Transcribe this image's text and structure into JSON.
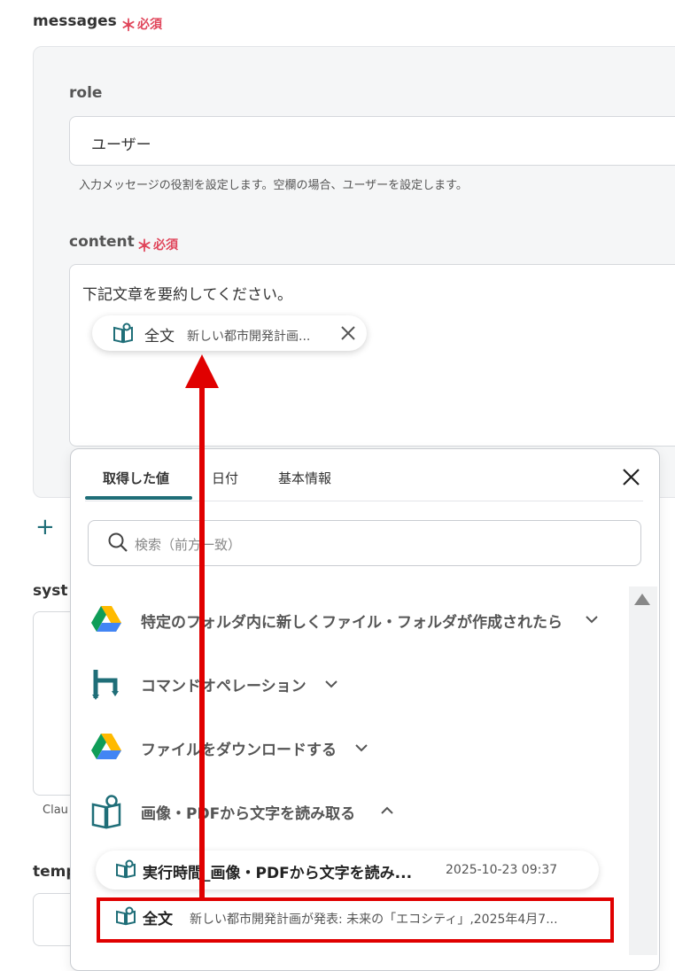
{
  "messages": {
    "label": "messages",
    "required_star": "＊",
    "required_text": "必須",
    "role": {
      "label": "role",
      "value": "ユーザー",
      "hint": "入力メッセージの役割を設定します。空欄の場合、ユーザーを設定します。"
    },
    "content": {
      "label": "content",
      "required_star": "＊",
      "required_text": "必須",
      "text": "下記文章を要約してください。",
      "chip": {
        "title": "全文",
        "value": "新しい都市開発計画..."
      }
    },
    "add_symbol": "+"
  },
  "left_partial": {
    "system_label": "syst",
    "claude_hint": "Clau",
    "temp_label": "temp"
  },
  "dropdown": {
    "tabs": [
      "取得した値",
      "日付",
      "基本情報"
    ],
    "active_tab": 0,
    "search_placeholder": "検索（前方一致）",
    "items": [
      {
        "icon": "google-drive-icon",
        "label": "特定のフォルダ内に新しくファイル・フォルダが作成されたら",
        "expanded": false
      },
      {
        "icon": "command-operation-icon",
        "label": "コマンドオペレーション",
        "expanded": false
      },
      {
        "icon": "google-drive-icon",
        "label": "ファイルをダウンロードする",
        "expanded": false
      },
      {
        "icon": "ocr-book-icon",
        "label": "画像・PDFから文字を読み取る",
        "expanded": true
      }
    ],
    "sub_items": [
      {
        "title": "実行時間_画像・PDFから文字を読み...",
        "meta": "2025-10-23 09:37"
      },
      {
        "title": "全文",
        "meta": "新しい都市開発計画が発表: 未来の「エコシティ」,2025年4月7..."
      }
    ]
  },
  "colors": {
    "accent": "#1f6e78",
    "required": "#e0455a",
    "annotation": "#e00000"
  }
}
